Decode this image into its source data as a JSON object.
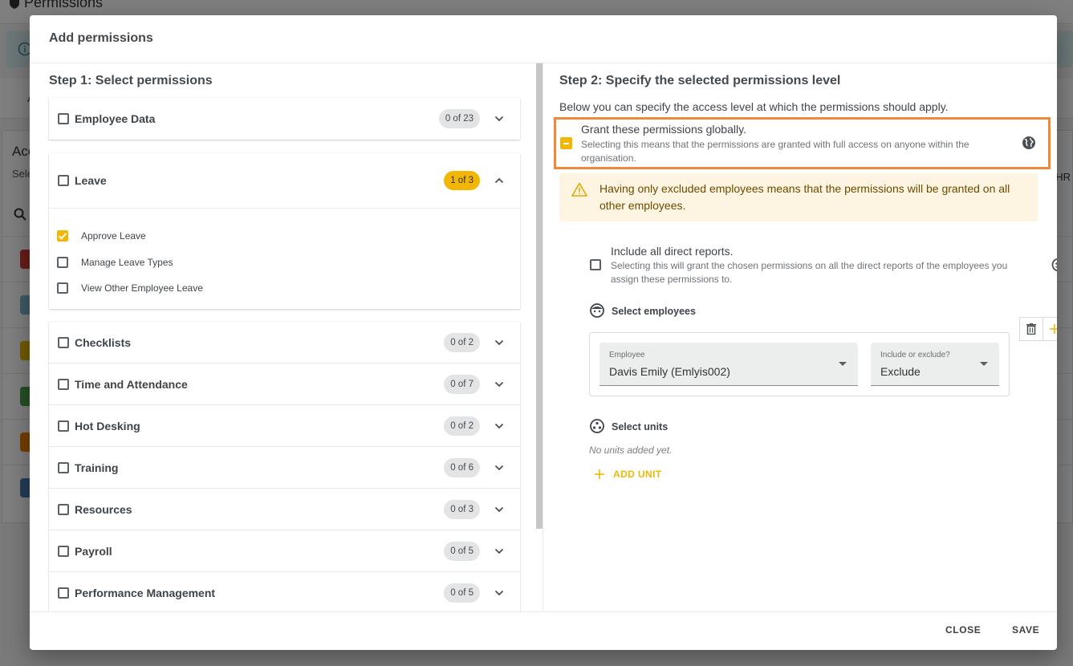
{
  "background": {
    "page_title": "Permissions",
    "tab_label": "A",
    "card_title": "Acc",
    "card_subtitle": "Sele",
    "column_fragment": "HR",
    "row_colors": [
      "#d23a32",
      "#7fb6cf",
      "#e6b800",
      "#4aa34a",
      "#ef7d00",
      "#4a7ab0"
    ]
  },
  "dialog": {
    "title": "Add permissions",
    "close_label": "CLOSE",
    "save_label": "SAVE"
  },
  "step1": {
    "title": "Step 1: Select permissions",
    "categories": [
      {
        "label": "Employee Data",
        "count": "0 of 23",
        "expanded": false
      },
      {
        "label": "Leave",
        "count": "1 of 3",
        "expanded": true
      },
      {
        "label": "Checklists",
        "count": "0 of 2",
        "expanded": false
      },
      {
        "label": "Time and Attendance",
        "count": "0 of 7",
        "expanded": false
      },
      {
        "label": "Hot Desking",
        "count": "0 of 2",
        "expanded": false
      },
      {
        "label": "Training",
        "count": "0 of 6",
        "expanded": false
      },
      {
        "label": "Resources",
        "count": "0 of 3",
        "expanded": false
      },
      {
        "label": "Payroll",
        "count": "0 of 5",
        "expanded": false
      },
      {
        "label": "Performance Management",
        "count": "0 of 5",
        "expanded": false
      }
    ],
    "leave_items": [
      {
        "label": "Approve Leave",
        "checked": true
      },
      {
        "label": "Manage Leave Types",
        "checked": false
      },
      {
        "label": "View Other Employee Leave",
        "checked": false
      }
    ]
  },
  "step2": {
    "title": "Step 2: Specify the selected permissions level",
    "intro": "Below you can specify the access level at which the permissions should apply.",
    "global": {
      "title": "Grant these permissions globally.",
      "description": "Selecting this means that the permissions are granted with full access on anyone within the organisation."
    },
    "warning": "Having only excluded employees means that the permissions will be granted on all other employees.",
    "direct_reports": {
      "title": "Include all direct reports.",
      "description": "Selecting this will grant the chosen permissions on all the direct reports of the employees you assign these permissions to."
    },
    "select_employees_label": "Select employees",
    "employee_field": {
      "label": "Employee",
      "value": "Davis Emily (Emlyis002)"
    },
    "include_field": {
      "label": "Include or exclude?",
      "value": "Exclude"
    },
    "select_units_label": "Select units",
    "no_units": "No units added yet.",
    "add_unit_label": "ADD UNIT"
  },
  "colors": {
    "accent": "#f2b704",
    "highlight_border": "#f0883a",
    "warning_bg": "#fdf5e1"
  }
}
